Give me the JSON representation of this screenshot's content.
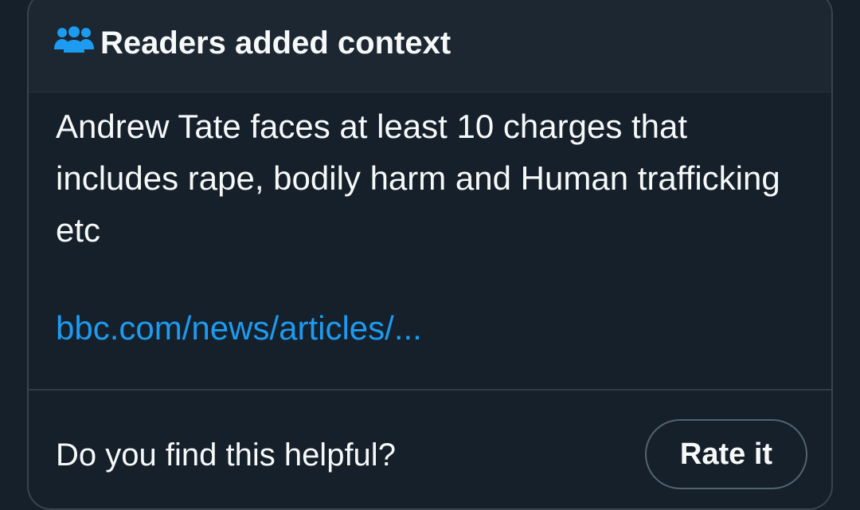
{
  "note": {
    "header": {
      "icon": "people-group-icon",
      "icon_color": "#1d9bf0",
      "title": "Readers added context"
    },
    "context_text": "Andrew Tate faces at least 10 charges that includes rape, bodily harm and Human trafficking etc",
    "source_link": "bbc.com/news/articles/...",
    "footer": {
      "question": "Do you find this helpful?",
      "rate_button_label": "Rate it"
    }
  },
  "colors": {
    "background": "#15202b",
    "header_background": "#1c2732",
    "text": "#f7f9f9",
    "link": "#1d9bf0",
    "border": "#38444d"
  }
}
